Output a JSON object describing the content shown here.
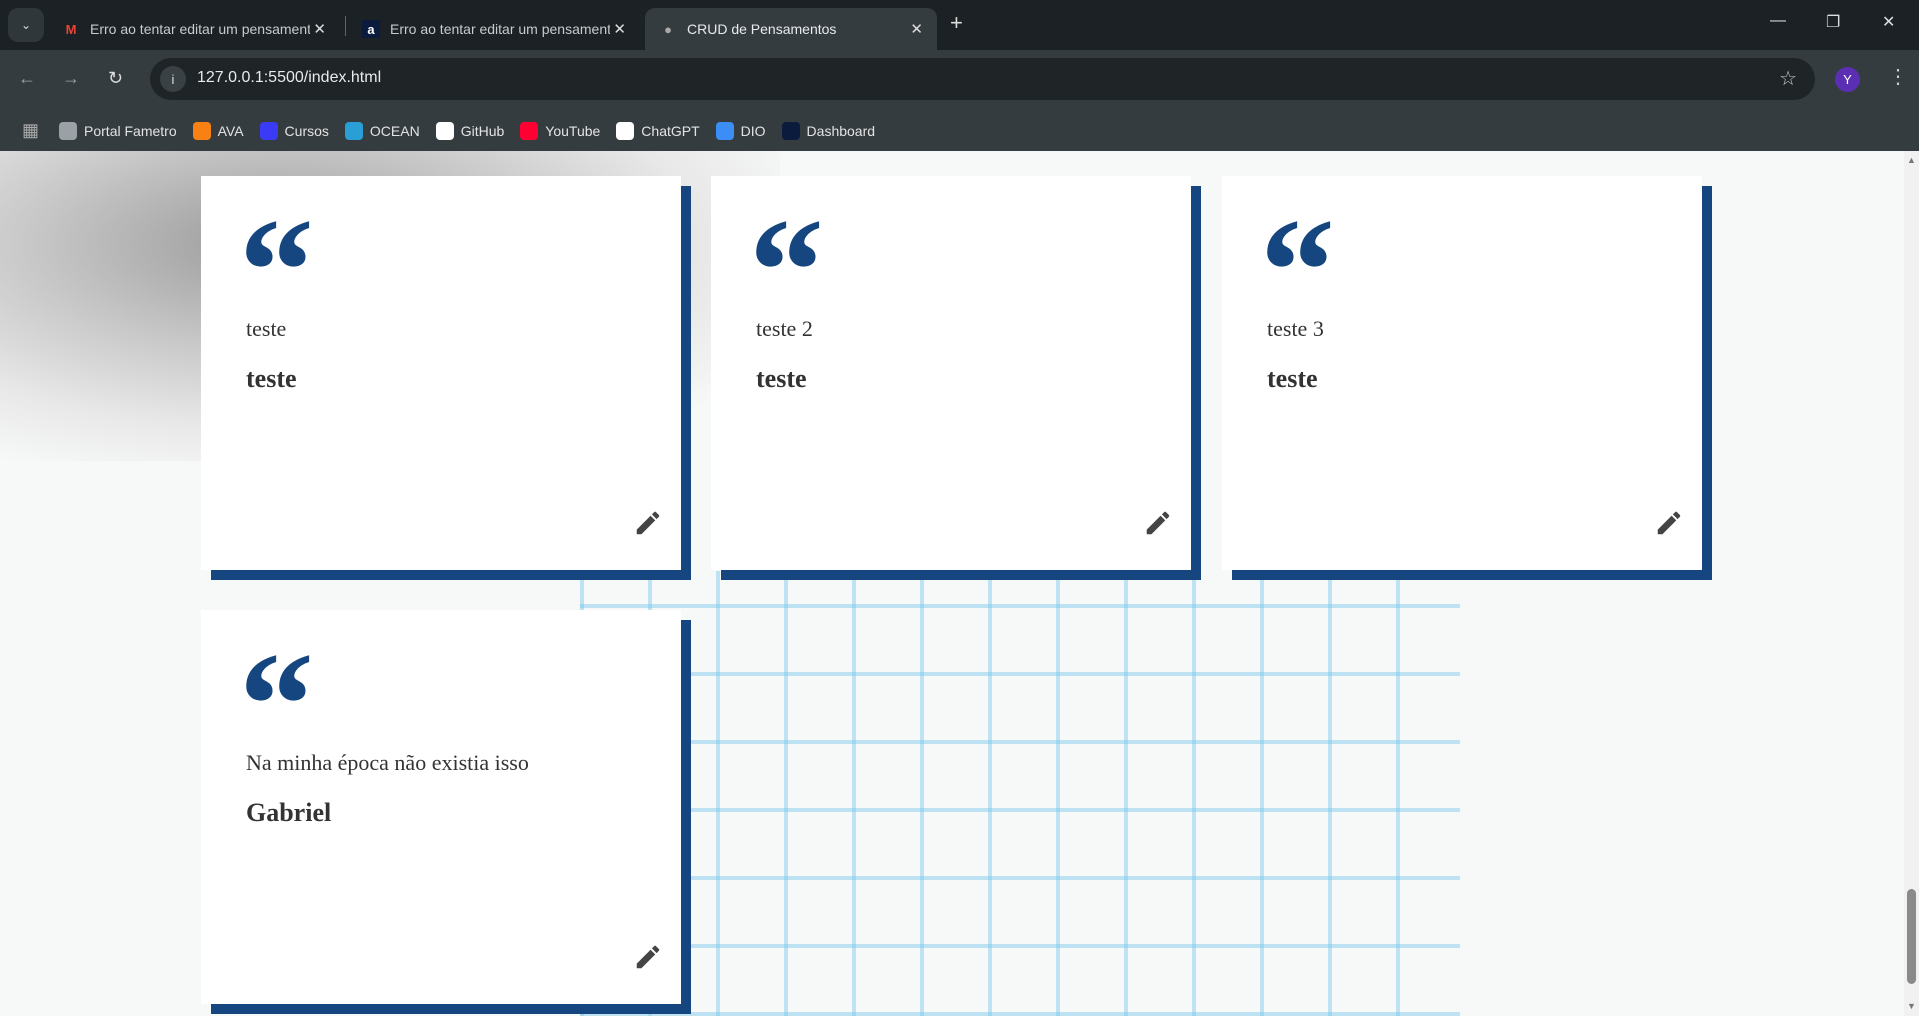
{
  "browser": {
    "tabs": [
      {
        "title": "Erro ao tentar editar um pensamento",
        "icon": "gmail-icon",
        "active": false
      },
      {
        "title": "Erro ao tentar editar um pensamento",
        "icon": "alura-icon",
        "active": false
      },
      {
        "title": "CRUD de Pensamentos",
        "icon": "globe-icon",
        "active": true
      }
    ],
    "url": "127.0.0.1:5500/index.html",
    "profile_initial": "Y",
    "bookmarks": [
      {
        "label": "Portal Fametro",
        "icon": "globe-icon",
        "color": "#9aa0a6"
      },
      {
        "label": "AVA",
        "icon": "moodle-icon",
        "color": "#f98012"
      },
      {
        "label": "Cursos",
        "icon": "cursos-icon",
        "color": "#3b3bf5"
      },
      {
        "label": "OCEAN",
        "icon": "ocean-icon",
        "color": "#2a9fd6"
      },
      {
        "label": "GitHub",
        "icon": "github-icon",
        "color": "#ffffff"
      },
      {
        "label": "YouTube",
        "icon": "youtube-icon",
        "color": "#ff0033"
      },
      {
        "label": "ChatGPT",
        "icon": "chatgpt-icon",
        "color": "#ffffff"
      },
      {
        "label": "DIO",
        "icon": "dio-icon",
        "color": "#3a8ef6"
      },
      {
        "label": "Dashboard",
        "icon": "alura-icon",
        "color": "#0b1b3d"
      }
    ]
  },
  "theme": {
    "accent": "#164680"
  },
  "thoughts": [
    {
      "content": "teste",
      "author": "teste"
    },
    {
      "content": "teste 2",
      "author": "teste"
    },
    {
      "content": "teste 3",
      "author": "teste"
    },
    {
      "content": "Na minha época não existia isso",
      "author": "Gabriel"
    }
  ]
}
